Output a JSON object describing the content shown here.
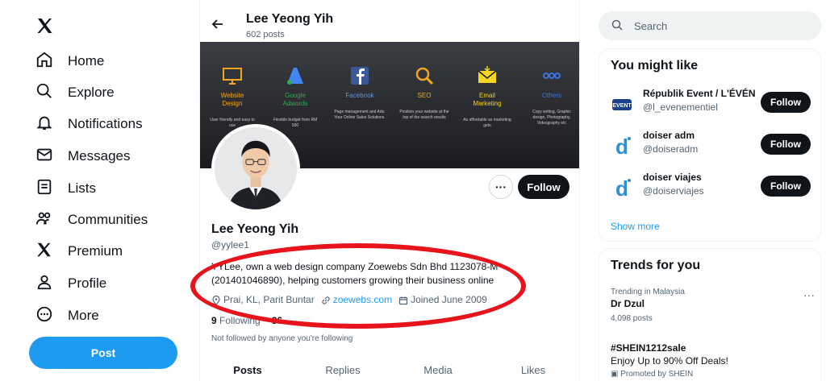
{
  "nav": {
    "items": [
      {
        "label": "Home",
        "icon": "home-icon"
      },
      {
        "label": "Explore",
        "icon": "search-icon"
      },
      {
        "label": "Notifications",
        "icon": "bell-icon"
      },
      {
        "label": "Messages",
        "icon": "mail-icon"
      },
      {
        "label": "Lists",
        "icon": "list-icon"
      },
      {
        "label": "Communities",
        "icon": "people-icon"
      },
      {
        "label": "Premium",
        "icon": "x-logo-icon"
      },
      {
        "label": "Profile",
        "icon": "person-icon"
      },
      {
        "label": "More",
        "icon": "more-circle-icon"
      }
    ],
    "post_label": "Post"
  },
  "header": {
    "name": "Lee Yeong Yih",
    "posts": "602 posts"
  },
  "banner": {
    "items": [
      {
        "title": "Website\nDesign",
        "desc": "User friendly and easy to use",
        "color": "#f4a623"
      },
      {
        "title": "Google\nAdwords",
        "desc": "Flexible budget from RM 500",
        "color": "#34a853"
      },
      {
        "title": "Facebook",
        "desc": "Page management and Ads. Your Online Sales Solutions.",
        "color": "#3b5998"
      },
      {
        "title": "SEO",
        "desc": "Position your website at the top of the search results",
        "color": "#f4a623"
      },
      {
        "title": "Email\nMarketing",
        "desc": "As affordable as marketing gets",
        "color": "#f4d623"
      },
      {
        "title": "Others",
        "desc": "Copy writing, Graphic design, Photography, Videography etc",
        "color": "#3b78e7"
      }
    ]
  },
  "profile": {
    "name": "Lee Yeong Yih",
    "handle": "@yylee1",
    "bio": "YYLee, own a web design company Zoewebs Sdn Bhd 1123078-M (201401046890), helping customers growing their business online",
    "location": "Prai, KL, Parit Buntar",
    "website": "zoewebs.com",
    "joined": "Joined June 2009",
    "following_count": "9",
    "following_label": "Following",
    "followers_count": "86",
    "not_followed": "Not followed by anyone you're following",
    "follow_label": "Follow",
    "more_label": "···"
  },
  "tabs": [
    "Posts",
    "Replies",
    "Media",
    "Likes"
  ],
  "search": {
    "placeholder": "Search"
  },
  "might_like": {
    "title": "You might like",
    "users": [
      {
        "name": "Républik Event / L'ÉVÉN",
        "handle": "@l_evenementiel"
      },
      {
        "name": "doiser adm",
        "handle": "@doiseradm"
      },
      {
        "name": "doiser viajes",
        "handle": "@doiserviajes"
      }
    ],
    "follow_label": "Follow",
    "show_more": "Show more"
  },
  "trends": {
    "title": "Trends for you",
    "items": [
      {
        "context": "Trending in Malaysia",
        "title": "Dr Dzul",
        "count": "4,098 posts"
      },
      {
        "context": "",
        "title": "#SHEIN1212sale",
        "count": "Enjoy Up to 90% Off Deals!"
      }
    ],
    "promoted": "Promoted by SHEIN"
  },
  "colors": {
    "accent": "#1d9bf0",
    "annotation": "#e8141b"
  }
}
